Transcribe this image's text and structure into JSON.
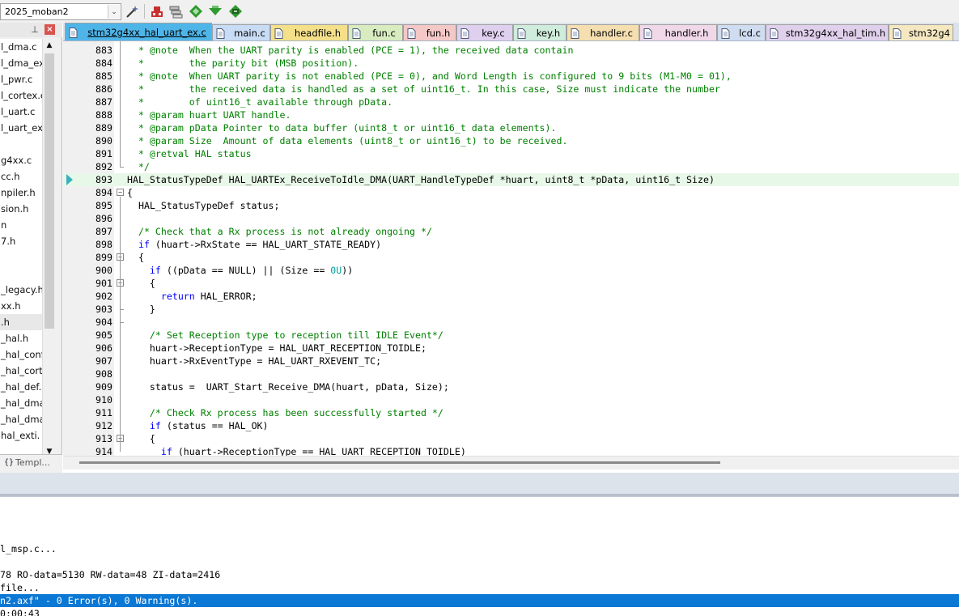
{
  "toolbar": {
    "target_name": "2025_moban2",
    "buttons": [
      "wand-icon",
      "insert-icon",
      "stack-icon",
      "diamond-green-icon",
      "download-green-icon",
      "chip-green-icon"
    ]
  },
  "project_panel": {
    "files": [
      "l_dma.c",
      "l_dma_ex.",
      "l_pwr.c",
      "l_cortex.c",
      "l_uart.c",
      "l_uart_ex.c",
      "",
      "g4xx.c",
      "cc.h",
      "npiler.h",
      "sion.h",
      "n",
      "7.h",
      "",
      "",
      "_legacy.h",
      "xx.h",
      ".h",
      "_hal.h",
      "_hal_conf",
      "_hal_corte",
      "_hal_def.h",
      "_hal_dma",
      "_hal_dma",
      "hal_exti."
    ],
    "selected_index": 17,
    "bottom_tab": "Templ..."
  },
  "editor_tabs": [
    {
      "label": "stm32g4xx_hal_uart_ex.c",
      "color": "#4fb5e8",
      "active": true
    },
    {
      "label": "main.c",
      "color": "#c8dcf5",
      "active": false
    },
    {
      "label": "headfile.h",
      "color": "#f5e08a",
      "active": false
    },
    {
      "label": "fun.c",
      "color": "#d8ecc0",
      "active": false
    },
    {
      "label": "fun.h",
      "color": "#f5c8c8",
      "active": false
    },
    {
      "label": "key.c",
      "color": "#e0d0f0",
      "active": false
    },
    {
      "label": "key.h",
      "color": "#d0ecdc",
      "active": false
    },
    {
      "label": "handler.c",
      "color": "#f5dfb0",
      "active": false
    },
    {
      "label": "handler.h",
      "color": "#f0d8e8",
      "active": false
    },
    {
      "label": "lcd.c",
      "color": "#d0dcf0",
      "active": false
    },
    {
      "label": "stm32g4xx_hal_tim.h",
      "color": "#e0d0ec",
      "active": false
    },
    {
      "label": "stm32g4",
      "color": "#f5e8c0",
      "active": false
    }
  ],
  "code": [
    {
      "n": "883",
      "segs": [
        [
          "c",
          "  * @note  When the UART parity is enabled (PCE = 1), the received data contain"
        ]
      ]
    },
    {
      "n": "884",
      "segs": [
        [
          "c",
          "  *        the parity bit (MSB position)."
        ]
      ]
    },
    {
      "n": "885",
      "segs": [
        [
          "c",
          "  * @note  When UART parity is not enabled (PCE = 0), and Word Length is configured to 9 bits (M1-M0 = 01),"
        ]
      ]
    },
    {
      "n": "886",
      "segs": [
        [
          "c",
          "  *        the received data is handled as a set of uint16_t. In this case, Size must indicate the number"
        ]
      ]
    },
    {
      "n": "887",
      "segs": [
        [
          "c",
          "  *        of uint16_t available through pData."
        ]
      ]
    },
    {
      "n": "888",
      "segs": [
        [
          "c",
          "  * @param huart UART handle."
        ]
      ]
    },
    {
      "n": "889",
      "segs": [
        [
          "c",
          "  * @param pData Pointer to data buffer (uint8_t or uint16_t data elements)."
        ]
      ]
    },
    {
      "n": "890",
      "segs": [
        [
          "c",
          "  * @param Size  Amount of data elements (uint8_t or uint16_t) to be received."
        ]
      ]
    },
    {
      "n": "891",
      "segs": [
        [
          "c",
          "  * @retval HAL status"
        ]
      ]
    },
    {
      "n": "892",
      "segs": [
        [
          "c",
          "  */"
        ]
      ]
    },
    {
      "n": "893",
      "segs": [
        [
          "t",
          "HAL_StatusTypeDef HAL_UARTEx_ReceiveToIdle_DMA(UART_HandleTypeDef *huart, uint8_t *pData, uint16_t Size)"
        ]
      ]
    },
    {
      "n": "894",
      "segs": [
        [
          "t",
          "{"
        ]
      ]
    },
    {
      "n": "895",
      "segs": [
        [
          "t",
          "  HAL_StatusTypeDef status;"
        ]
      ]
    },
    {
      "n": "896",
      "segs": [
        [
          "t",
          ""
        ]
      ]
    },
    {
      "n": "897",
      "segs": [
        [
          "c",
          "  /* Check that a Rx process is not already ongoing */"
        ]
      ]
    },
    {
      "n": "898",
      "segs": [
        [
          "k",
          "  if"
        ],
        [
          "t",
          " (huart->RxState == HAL_UART_STATE_READY)"
        ]
      ]
    },
    {
      "n": "899",
      "segs": [
        [
          "t",
          "  {"
        ]
      ]
    },
    {
      "n": "900",
      "segs": [
        [
          "k",
          "    if"
        ],
        [
          "t",
          " ((pData == NULL) || (Size == "
        ],
        [
          "n",
          "0U"
        ],
        [
          "t",
          "))"
        ]
      ]
    },
    {
      "n": "901",
      "segs": [
        [
          "t",
          "    {"
        ]
      ]
    },
    {
      "n": "902",
      "segs": [
        [
          "k",
          "      return"
        ],
        [
          "t",
          " HAL_ERROR;"
        ]
      ]
    },
    {
      "n": "903",
      "segs": [
        [
          "t",
          "    }"
        ]
      ]
    },
    {
      "n": "904",
      "segs": [
        [
          "t",
          ""
        ]
      ]
    },
    {
      "n": "905",
      "segs": [
        [
          "c",
          "    /* Set Reception type to reception till IDLE Event*/"
        ]
      ]
    },
    {
      "n": "906",
      "segs": [
        [
          "t",
          "    huart->ReceptionType = HAL_UART_RECEPTION_TOIDLE;"
        ]
      ]
    },
    {
      "n": "907",
      "segs": [
        [
          "t",
          "    huart->RxEventType = HAL_UART_RXEVENT_TC;"
        ]
      ]
    },
    {
      "n": "908",
      "segs": [
        [
          "t",
          ""
        ]
      ]
    },
    {
      "n": "909",
      "segs": [
        [
          "t",
          "    status =  UART_Start_Receive_DMA(huart, pData, Size);"
        ]
      ]
    },
    {
      "n": "910",
      "segs": [
        [
          "t",
          ""
        ]
      ]
    },
    {
      "n": "911",
      "segs": [
        [
          "c",
          "    /* Check Rx process has been successfully started */"
        ]
      ]
    },
    {
      "n": "912",
      "segs": [
        [
          "k",
          "    if"
        ],
        [
          "t",
          " (status == HAL_OK)"
        ]
      ]
    },
    {
      "n": "913",
      "segs": [
        [
          "t",
          "    {"
        ]
      ]
    },
    {
      "n": "914",
      "segs": [
        [
          "k",
          "      if"
        ],
        [
          "t",
          " (huart->ReceptionType == HAL_UART_RECEPTION_TOIDLE)"
        ]
      ]
    }
  ],
  "current_line": "893",
  "build_output": [
    {
      "text": "",
      "hl": false
    },
    {
      "text": "",
      "hl": false
    },
    {
      "text": "l_msp.c...",
      "hl": false
    },
    {
      "text": "",
      "hl": false
    },
    {
      "text": "78 RO-data=5130 RW-data=48 ZI-data=2416",
      "hl": false
    },
    {
      "text": "file...",
      "hl": false
    },
    {
      "text": "n2.axf\" - 0 Error(s), 0 Warning(s).",
      "hl": true
    },
    {
      "text": "0:00:43",
      "hl": false
    }
  ]
}
